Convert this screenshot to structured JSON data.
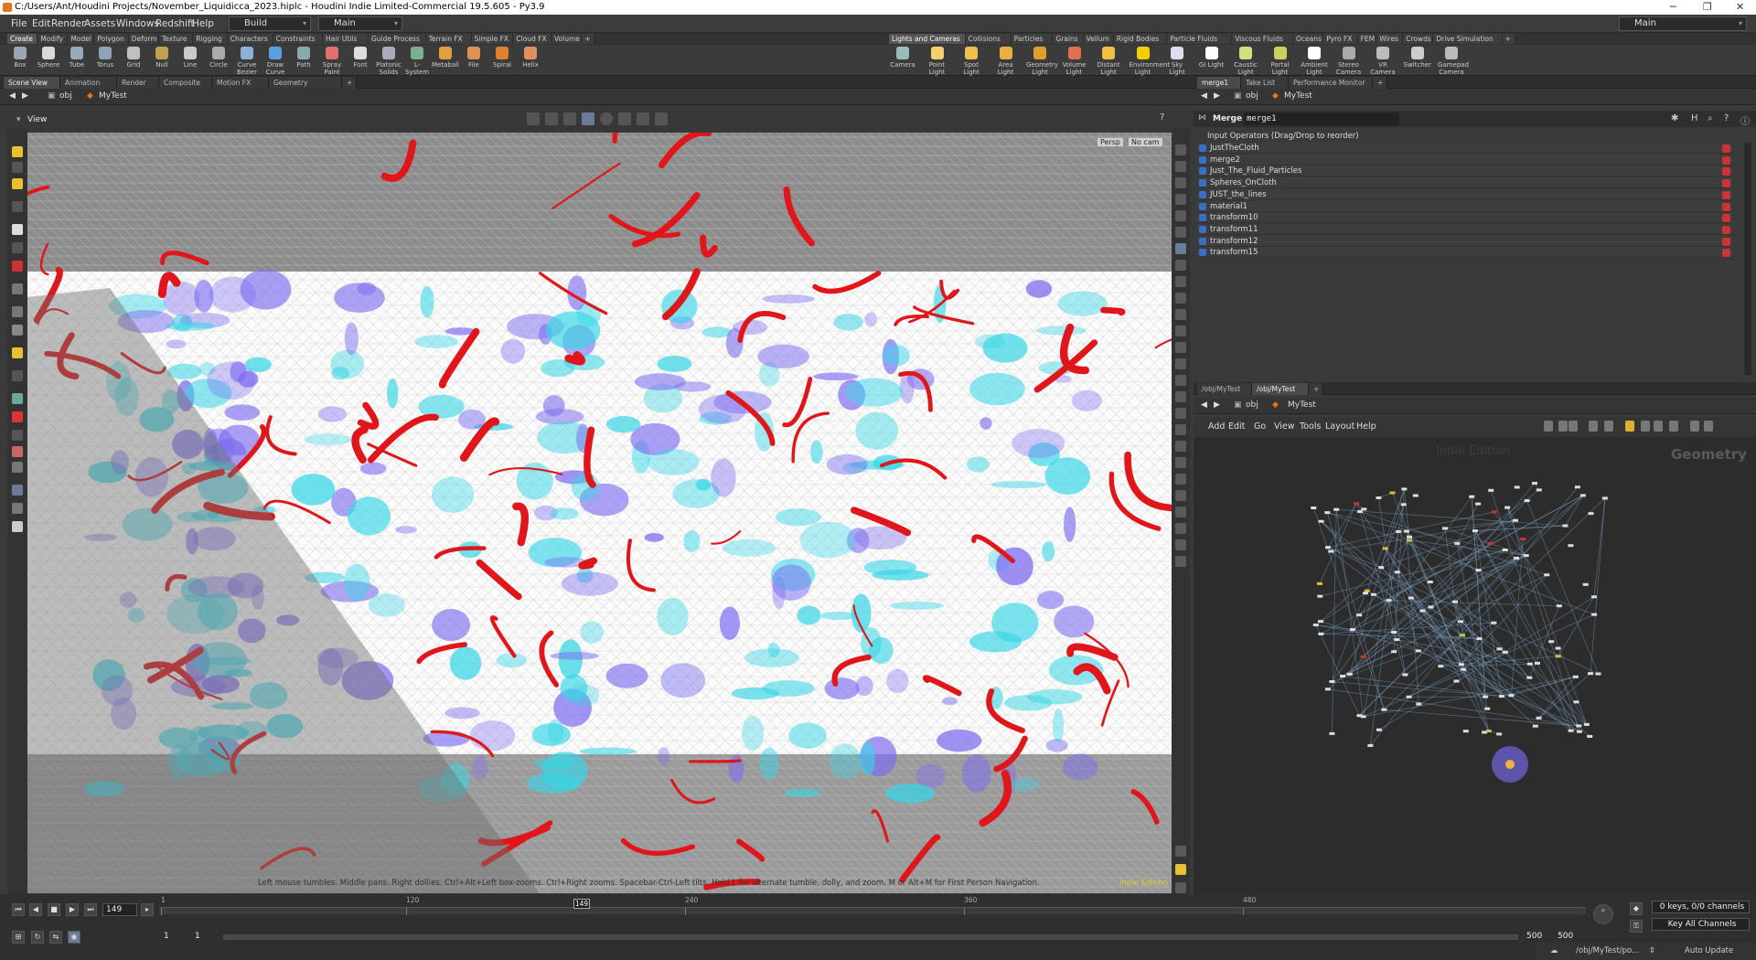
{
  "window": {
    "title": "C:/Users/Ant/Houdini Projects/November_Liquidicca_2023.hiplc - Houdini Indie Limited-Commercial 19.5.605 - Py3.9",
    "controls": [
      "─",
      "❐",
      "✕"
    ]
  },
  "menubar": {
    "items": [
      "File",
      "Edit",
      "Render",
      "Assets",
      "Windows",
      "Redshift",
      "Help"
    ],
    "desktop_label": "Build",
    "context_label": "Main",
    "right_label": "Main"
  },
  "shelf_tabs_left": [
    "Create",
    "Modify",
    "Model",
    "Polygon",
    "Deform",
    "Texture",
    "Rigging",
    "Characters",
    "Constraints",
    "Hair Utils",
    "Guide Process",
    "Terrain FX",
    "Simple FX",
    "Cloud FX",
    "Volume",
    "+"
  ],
  "shelf_tabs_right": [
    "Lights and Cameras",
    "Collisions",
    "Particles",
    "Grains",
    "Vellum",
    "Rigid Bodies",
    "Particle Fluids",
    "Viscous Fluids",
    "Oceans",
    "Pyro FX",
    "FEM",
    "Wires",
    "Crowds",
    "Drive Simulation",
    "+"
  ],
  "shelf_tools_left": [
    "Box",
    "Sphere",
    "Tube",
    "Torus",
    "Grid",
    "Null",
    "Line",
    "Circle",
    "Curve Bezier",
    "Draw Curve",
    "Path",
    "Spray Paint",
    "Font",
    "Platonic Solids",
    "L-System",
    "Metaball",
    "File",
    "Spiral",
    "Helix"
  ],
  "shelf_tools_right": [
    "Camera",
    "Point Light",
    "Spot Light",
    "Area Light",
    "Geometry Light",
    "Volume Light",
    "Distant Light",
    "Environment Light",
    "Sky Light",
    "GI Light",
    "Caustic Light",
    "Portal Light",
    "Ambient Light",
    "Stereo Camera",
    "VR Camera",
    "Switcher",
    "Gamepad Camera"
  ],
  "left_pane": {
    "tabs": [
      "Scene View",
      "Animation Editor",
      "Render View",
      "Composite View",
      "Motion FX View",
      "Geometry Spreadsheet",
      "+"
    ],
    "path": [
      "obj",
      "MyTest"
    ],
    "view_label": "View",
    "persp_label": "Persp",
    "cam_label": "No cam",
    "hint": "Left mouse tumbles. Middle pans. Right dollies. Ctrl+Alt+Left box-zooms. Ctrl+Right zooms. Spacebar-Ctrl-Left tilts. Hold L for alternate tumble, dolly, and zoom.     M or Alt+M for First Person Navigation.",
    "edition": "Indie Edition"
  },
  "parm_pane": {
    "tabs": [
      "merge1",
      "Take List",
      "Performance Monitor",
      "+"
    ],
    "path": [
      "obj",
      "MyTest"
    ],
    "node_type": "Merge",
    "node_name": "merge1",
    "inputs_header": "Input Operators (Drag/Drop to reorder)",
    "inputs": [
      "JustTheCloth",
      "merge2",
      "Just_The_Fluid_Particles",
      "Spheres_OnCloth",
      "JUST_the_lines",
      "material1",
      "transform10",
      "transform11",
      "transform12",
      "transform15"
    ]
  },
  "network_pane": {
    "tabs": [
      "/obj/MyTest",
      "/obj/MyTest",
      "+"
    ],
    "path": [
      "obj",
      "MyTest"
    ],
    "menu": [
      "Add",
      "Edit",
      "Go",
      "View",
      "Tools",
      "Layout",
      "Help"
    ],
    "watermark": "Indie Edition",
    "context_label": "Geometry"
  },
  "timeline": {
    "current_frame": "149",
    "frame_marker": "149",
    "ticks": [
      "1",
      "120",
      "240",
      "360",
      "480"
    ],
    "start_a": "1",
    "start_b": "1",
    "end_a": "500",
    "end_b": "500",
    "keys_label": "0 keys, 0/0 channels",
    "key_all_label": "Key All Channels",
    "playhead_fraction": 0.296
  },
  "statusbar": {
    "path": "/obj/MyTest/po...",
    "update": "Auto Update"
  },
  "colors": {
    "accent": "#e8721a",
    "red_geo": "#e0161a",
    "cyan_particles": "#38d6e6",
    "violet_particles": "#7b6cf0"
  }
}
